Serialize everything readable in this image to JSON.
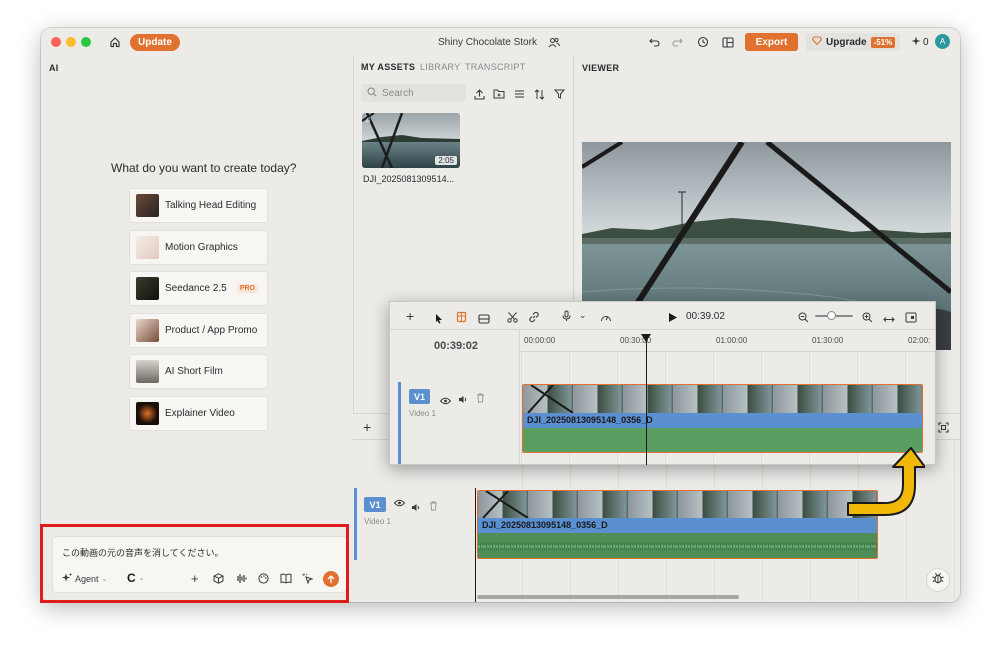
{
  "titlebar": {
    "update_label": "Update",
    "project_title": "Shiny Chocolate Stork",
    "export_label": "Export",
    "upgrade_label": "Upgrade",
    "upgrade_discount": "-51%",
    "credits": "0",
    "avatar_initial": "A"
  },
  "ai_panel": {
    "label": "AI",
    "prompt_title": "What do you want to create today?",
    "templates": [
      {
        "label": "Talking Head Editing",
        "badge": ""
      },
      {
        "label": "Motion Graphics",
        "badge": ""
      },
      {
        "label": "Seedance 2.5",
        "badge": "PRO"
      },
      {
        "label": "Product / App Promo",
        "badge": ""
      },
      {
        "label": "AI Short Film",
        "badge": ""
      },
      {
        "label": "Explainer Video",
        "badge": ""
      }
    ],
    "chat": {
      "text": "この動画の元の音声を消してください。",
      "agent_label": "Agent"
    }
  },
  "assets_panel": {
    "tabs": [
      "MY ASSETS",
      "LIBRARY",
      "TRANSCRIPT"
    ],
    "search_placeholder": "Search",
    "asset": {
      "name": "DJI_2025081309514...",
      "duration": "2:05"
    }
  },
  "viewer": {
    "label": "VIEWER"
  },
  "timeline": {
    "track_label": "V1",
    "track_name": "Video 1",
    "clip_name": "DJI_20250813095148_0356_D"
  },
  "zoom_timeline": {
    "timecode": "00:39:02",
    "current_time": "00:39.02",
    "ruler": [
      "00:00:00",
      "00:30:00",
      "01:00:00",
      "01:30:00",
      "02:00:"
    ],
    "track_label": "V1",
    "track_name": "Video 1",
    "clip_name": "DJI_20250813095148_0356_D"
  },
  "colors": {
    "accent": "#e0712e",
    "track_blue": "#5a8fd0",
    "audio_green": "#5a9e62",
    "highlight_red": "#e01b1b",
    "arrow_yellow": "#f2b807"
  }
}
